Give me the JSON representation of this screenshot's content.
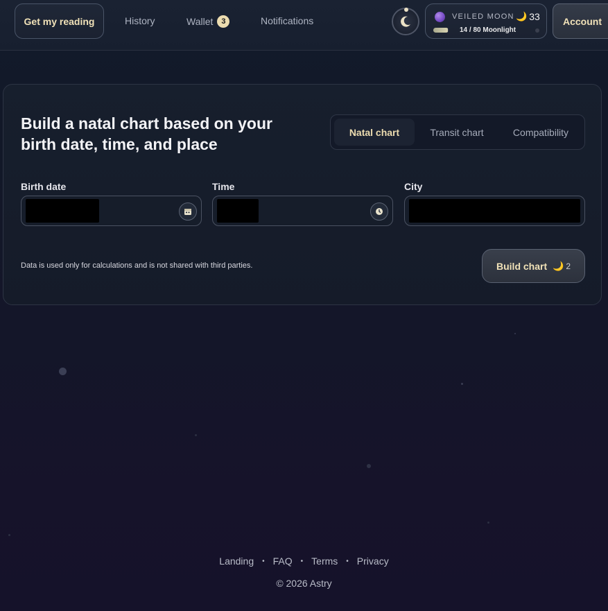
{
  "header": {
    "reading_button": "Get my reading",
    "nav": {
      "history": "History",
      "wallet": "Wallet",
      "wallet_badge": "3",
      "notifications": "Notifications"
    },
    "level": {
      "name": "VEILED MOON",
      "score": "33",
      "progress_label": "14 / 80 Moonlight",
      "progress_fraction": 0.175
    },
    "account_button": "Account"
  },
  "main": {
    "title": "Build a natal chart based on your birth date, time, and place",
    "tabs": [
      {
        "label": "Natal chart",
        "active": true
      },
      {
        "label": "Transit chart",
        "active": false
      },
      {
        "label": "Compatibility",
        "active": false
      }
    ],
    "fields": {
      "birth_date_label": "Birth date",
      "time_label": "Time",
      "city_label": "City"
    },
    "note": "Data is used only for calculations and is not shared with third parties.",
    "build_button": "Build chart",
    "build_cost": "2"
  },
  "footer": {
    "links": [
      "Landing",
      "FAQ",
      "Terms",
      "Privacy"
    ],
    "copyright": "© 2026 Astry"
  },
  "colors": {
    "accent_gold": "#ecdcb0",
    "background": "#141629",
    "orb_purple": "#7a4fc9"
  }
}
